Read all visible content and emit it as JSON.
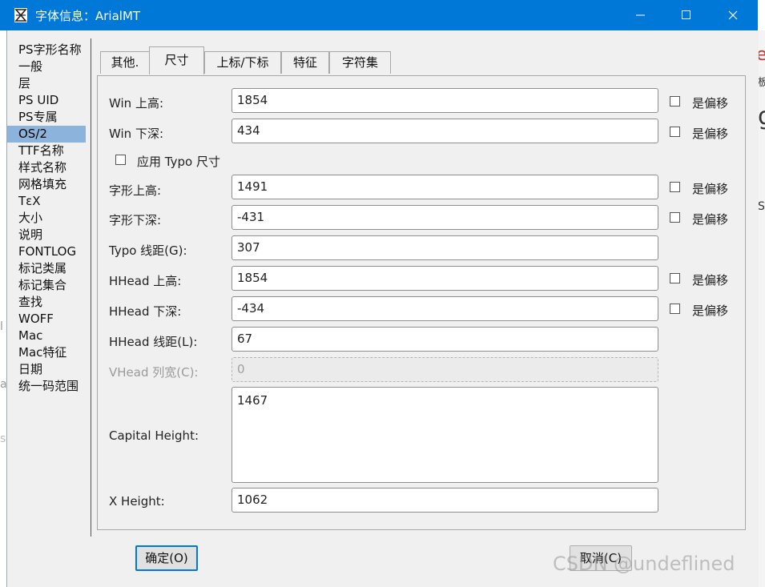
{
  "window": {
    "title": "字体信息：ArialMT"
  },
  "sidebar": {
    "items": [
      {
        "label": "PS字形名称"
      },
      {
        "label": "一般"
      },
      {
        "label": "层"
      },
      {
        "label": "PS UID"
      },
      {
        "label": "PS专属"
      },
      {
        "label": "OS/2"
      },
      {
        "label": "TTF名称"
      },
      {
        "label": "样式名称"
      },
      {
        "label": "网格填充"
      },
      {
        "label": "TεX"
      },
      {
        "label": "大小"
      },
      {
        "label": "说明"
      },
      {
        "label": "FONTLOG"
      },
      {
        "label": "标记类属"
      },
      {
        "label": "标记集合"
      },
      {
        "label": "查找"
      },
      {
        "label": "WOFF"
      },
      {
        "label": "Mac"
      },
      {
        "label": "Mac特征"
      },
      {
        "label": "日期"
      },
      {
        "label": "统一码范围"
      }
    ],
    "selected": "OS/2"
  },
  "tabs": [
    {
      "label": "其他."
    },
    {
      "label": "尺寸"
    },
    {
      "label": "上标/下标"
    },
    {
      "label": "特征"
    },
    {
      "label": "字符集"
    }
  ],
  "active_tab": "尺寸",
  "offset_label": "是偏移",
  "apply_typo_label": "应用 Typo 尺寸",
  "fields": {
    "win_ascent": {
      "label": "Win 上高:",
      "value": "1854"
    },
    "win_descent": {
      "label": "Win 下深:",
      "value": "434"
    },
    "typo_ascent": {
      "label": "字形上高:",
      "value": "1491"
    },
    "typo_descent": {
      "label": "字形下深:",
      "value": "-431"
    },
    "typo_linegap": {
      "label": "Typo 线距(G):",
      "value": "307"
    },
    "hhead_ascent": {
      "label": "HHead 上高:",
      "value": "1854"
    },
    "hhead_descent": {
      "label": "HHead 下深:",
      "value": "-434"
    },
    "hhead_linegap": {
      "label": "HHead 线距(L):",
      "value": "67"
    },
    "vhead_colspace": {
      "label": "VHead 列宽(C):",
      "value": "0"
    },
    "capital_height": {
      "label": "Capital Height:",
      "value": "1467"
    },
    "x_height": {
      "label": "X Height:",
      "value": "1062"
    }
  },
  "buttons": {
    "ok": "确定(O)",
    "cancel": "取消(C)"
  },
  "background": {
    "right_edge_text": [
      "e",
      "板",
      "g",
      "S",
      "l",
      "a",
      "s"
    ]
  },
  "watermark": "CSDN @undeflined",
  "colors": {
    "titlebar": "#0078d7",
    "selection": "#8cb3db",
    "dialog_bg": "#f0f0f0"
  }
}
